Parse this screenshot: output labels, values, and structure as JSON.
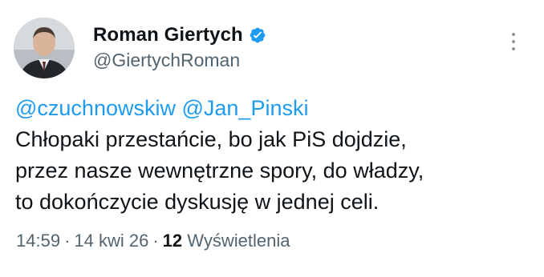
{
  "author": {
    "display_name": "Roman Giertych",
    "handle": "@GiertychRoman",
    "verified": true,
    "verified_color": "#1d9bf0"
  },
  "tweet": {
    "mentions": [
      "@czuchnowskiw",
      "@Jan_Pinski"
    ],
    "lines": [
      "Chłopaki przestańcie, bo jak PiS dojdzie,",
      "przez nasze wewnętrzne spory, do władzy,",
      "to dokończycie dyskusję w jednej celi."
    ]
  },
  "meta": {
    "time": "14:59",
    "separator": "·",
    "date": "14 kwi 26",
    "views_count": "12",
    "views_label": "Wyświetlenia"
  },
  "icons": {
    "verified": "verified-badge-icon",
    "more": "more-options-icon"
  },
  "colors": {
    "text": "#0f1419",
    "secondary": "#536471",
    "link": "#1d9bf0"
  }
}
